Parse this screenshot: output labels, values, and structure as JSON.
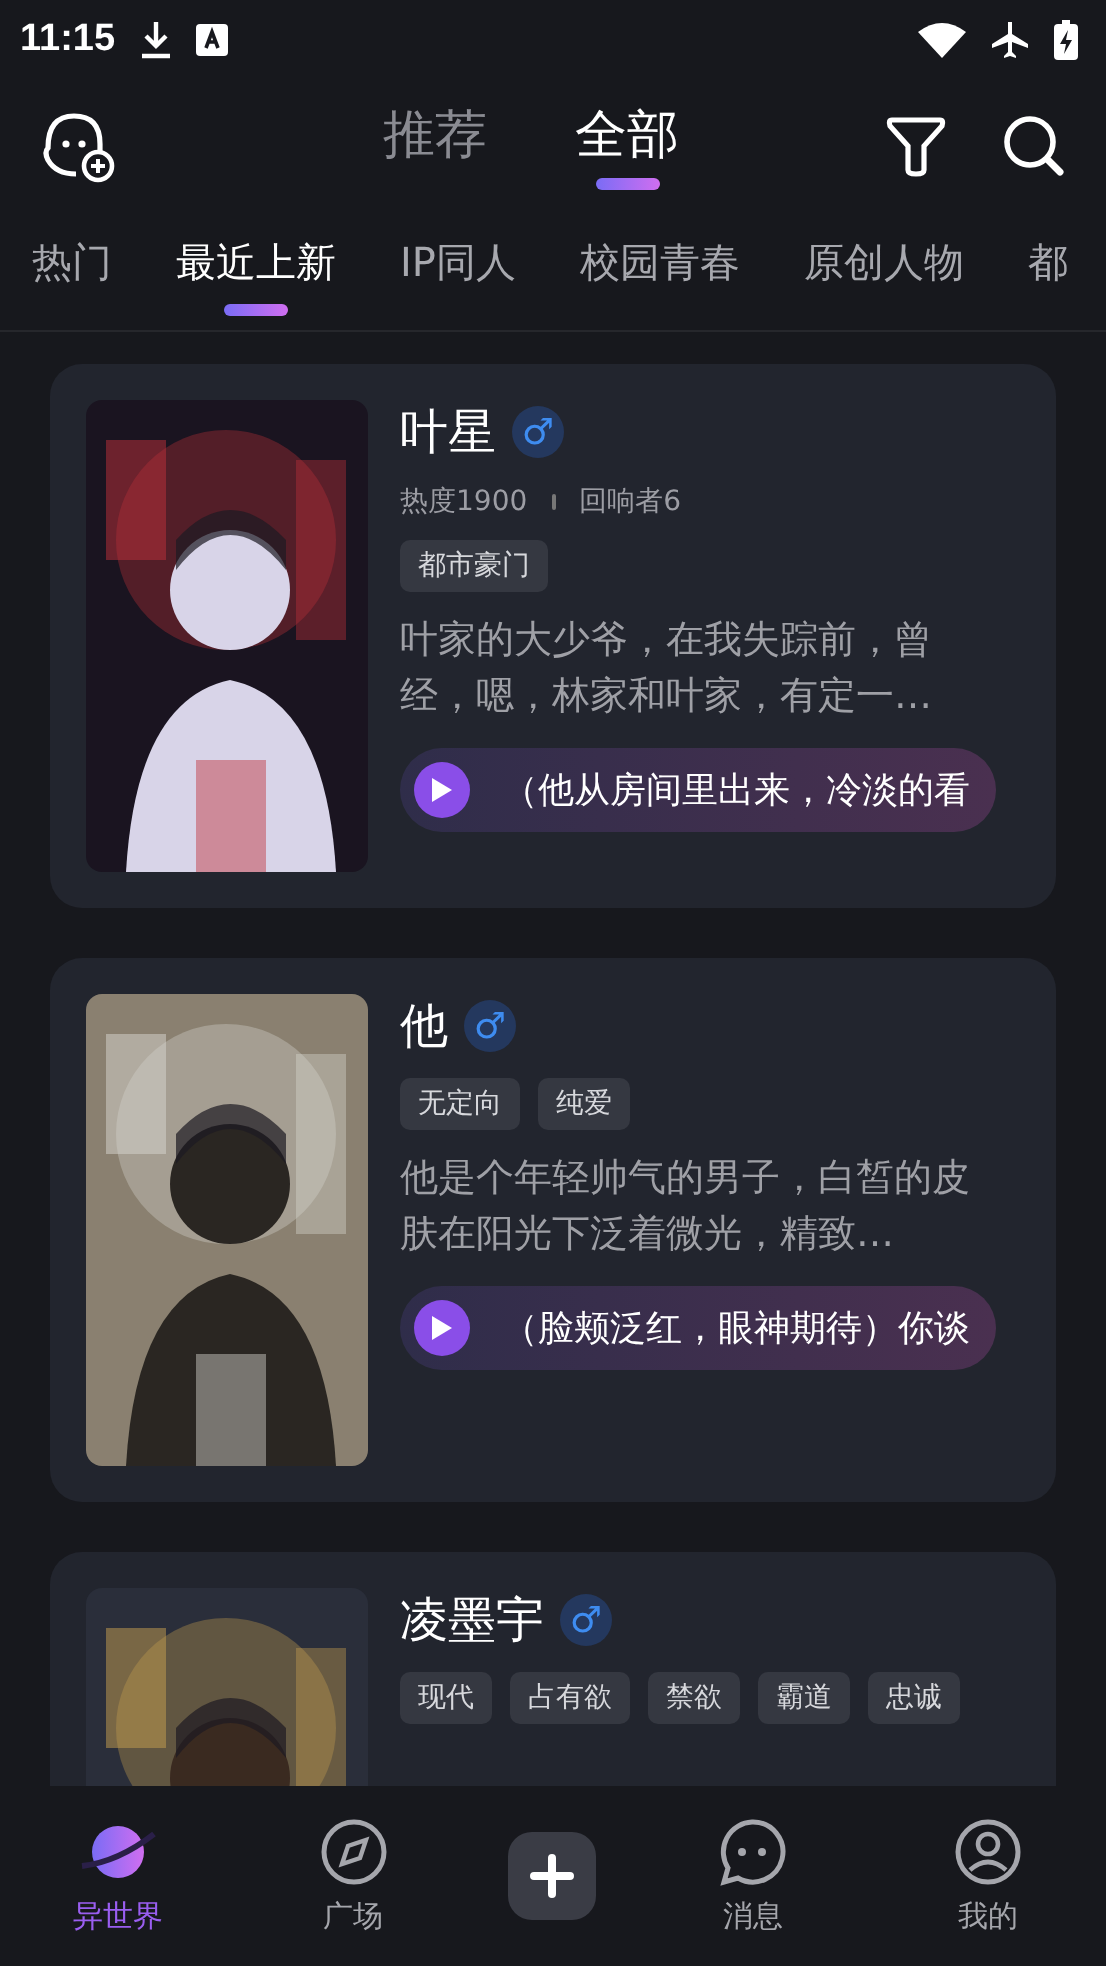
{
  "status_bar": {
    "time": "11:15"
  },
  "header": {
    "tabs": [
      {
        "label": "推荐",
        "selected": false
      },
      {
        "label": "全部",
        "selected": true
      }
    ]
  },
  "categories": [
    {
      "label": "热门",
      "selected": false
    },
    {
      "label": "最近上新",
      "selected": true
    },
    {
      "label": "IP同人",
      "selected": false
    },
    {
      "label": "校园青春",
      "selected": false
    },
    {
      "label": "原创人物",
      "selected": false
    },
    {
      "label": "都",
      "selected": false
    }
  ],
  "cards": [
    {
      "name": "叶星",
      "gender": "♂",
      "stats": [
        "热度1900",
        "回响者6"
      ],
      "tags": [
        "都市豪门"
      ],
      "description": "叶家的大少爷，在我失踪前，曾经，嗯，林家和叶家，有定一…",
      "voice_line": "（他从房间里出来，冷淡的看"
    },
    {
      "name": "他",
      "gender": "♂",
      "tags": [
        "无定向",
        "纯爱"
      ],
      "description": "他是个年轻帅气的男子，白皙的皮肤在阳光下泛着微光，精致…",
      "voice_line": "（脸颊泛红，眼神期待）你谈"
    },
    {
      "name": "凌墨宇",
      "gender": "♂",
      "tags": [
        "现代",
        "占有欲",
        "禁欲",
        "霸道",
        "忠诚"
      ]
    }
  ],
  "bottom_nav": [
    {
      "label": "异世界",
      "selected": true
    },
    {
      "label": "广场",
      "selected": false
    },
    {
      "label": "消息",
      "selected": false
    },
    {
      "label": "我的",
      "selected": false
    }
  ]
}
